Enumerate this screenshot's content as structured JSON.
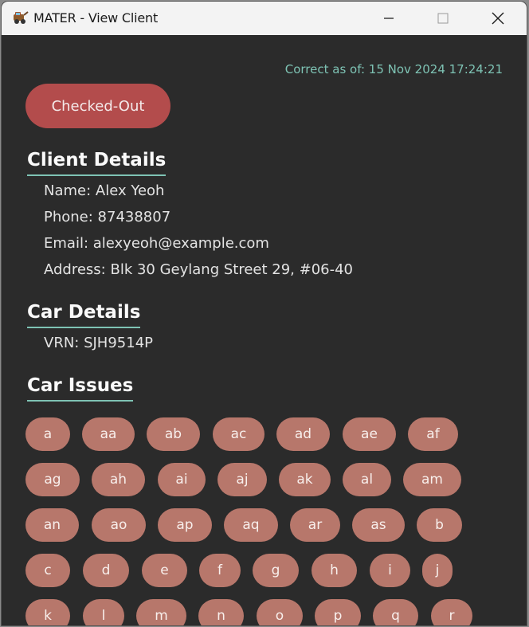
{
  "window": {
    "title": "MATER - View Client",
    "app_icon": "tow-truck-icon",
    "controls": [
      "minimize-icon",
      "maximize-icon",
      "close-icon"
    ]
  },
  "header": {
    "timestamp": "Correct as of: 15 Nov 2024 17:24:21",
    "status_button": "Checked-Out",
    "status_color": "#b34c4c"
  },
  "client_details": {
    "title": "Client Details",
    "name": "Name: Alex Yeoh",
    "phone": "Phone: 87438807",
    "email": "Email: alexyeoh@example.com",
    "address": "Address: Blk 30 Geylang Street 29, #06-40"
  },
  "car_details": {
    "title": "Car Details",
    "vrn": "VRN: SJH9514P"
  },
  "car_issues": {
    "title": "Car Issues",
    "tag_color": "#b7776b",
    "rows": [
      [
        "a",
        "aa",
        "ab",
        "ac",
        "ad",
        "ae",
        "af"
      ],
      [
        "ag",
        "ah",
        "ai",
        "aj",
        "ak",
        "al",
        "am"
      ],
      [
        "an",
        "ao",
        "ap",
        "aq",
        "ar",
        "as",
        "b"
      ],
      [
        "c",
        "d",
        "e",
        "f",
        "g",
        "h",
        "i",
        "j"
      ],
      [
        "k",
        "l",
        "m",
        "n",
        "o",
        "p",
        "q",
        "r"
      ]
    ]
  },
  "accent_color": "#7ec3b4"
}
